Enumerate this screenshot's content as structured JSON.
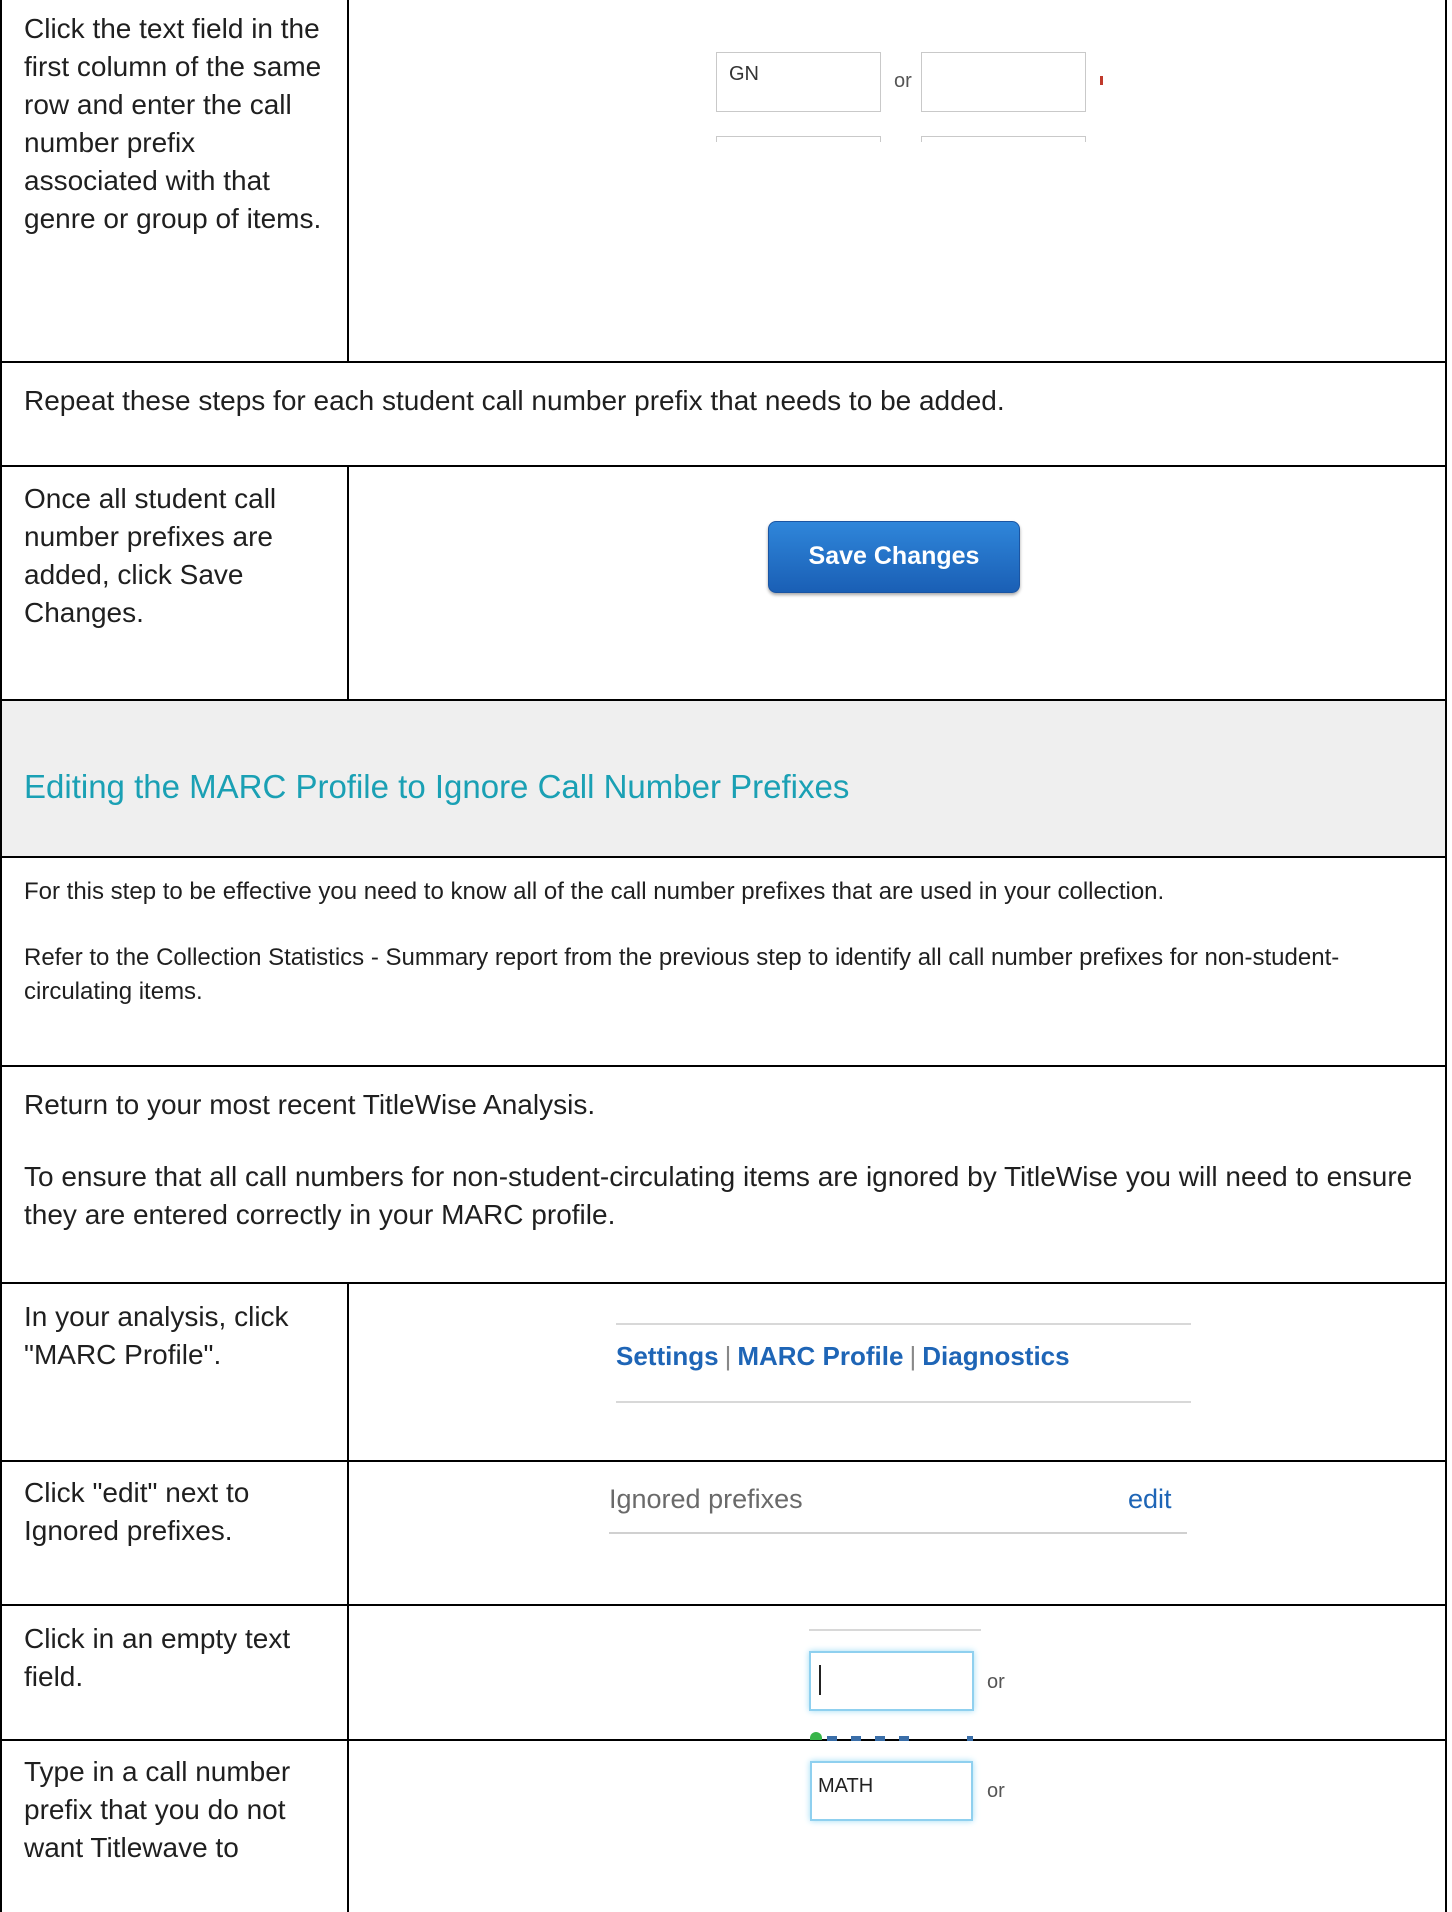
{
  "rows": {
    "r1_text": "Click the text field in the first column of the same row and enter the call number prefix associated with that genre or group of items.",
    "r1_field1": "GN",
    "r1_or": "or",
    "r2_text": "Repeat these steps for each student call number prefix that needs to be added.",
    "r3_text": "Once all student call number prefixes are added, click Save Changes.",
    "r3_button": "Save Changes",
    "heading": "Editing the MARC Profile to Ignore Call Number Prefixes",
    "r5_p1": "For this step to be effective you need to know all of the call number prefixes that are used in your collection.",
    "r5_p2": "Refer to the Collection Statistics - Summary report from the previous step to identify all call number prefixes for non-student-circulating items.",
    "r6_p1": "Return to your most recent TitleWise Analysis.",
    "r6_p2": "To ensure that all call numbers for non-student-circulating items are ignored by TitleWise you will need to ensure they are entered correctly in your MARC profile.",
    "r7_text": "In your analysis, click \"MARC Profile\".",
    "nav": {
      "settings": "Settings",
      "sep": "|",
      "marc": "MARC Profile",
      "diagnostics": "Diagnostics"
    },
    "r8_text": "Click \"edit\" next to Ignored prefixes.",
    "r8_label": "Ignored prefixes",
    "r8_edit": "edit",
    "r9_text": "Click in an empty text field.",
    "r9_or": "or",
    "r10_text": "Type in a call number prefix that you do not want Titlewave to",
    "r10_value": "MATH",
    "r10_or": "or"
  },
  "colors": {
    "heading": "#1aa0b4",
    "link": "#1e65b6",
    "button": "#1a5fb5",
    "grayband": "#efefef"
  }
}
